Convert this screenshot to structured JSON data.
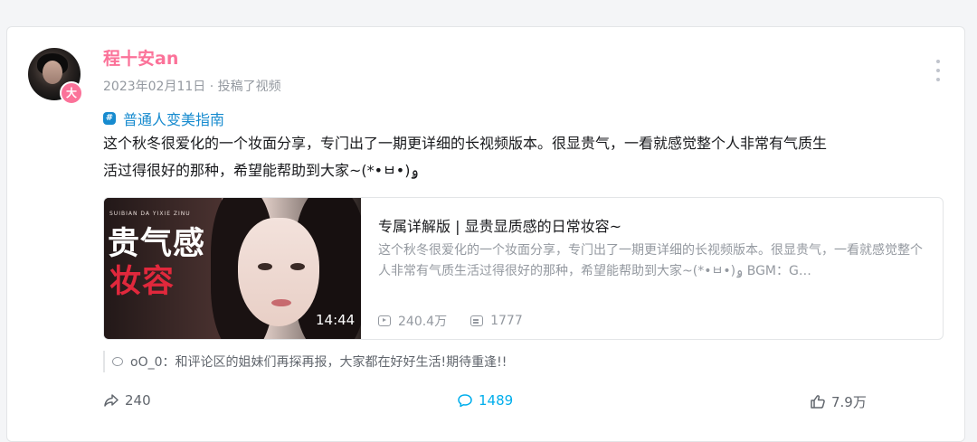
{
  "post": {
    "author": "程十安an",
    "avatar_badge": "大",
    "meta": "2023年02月11日 · 投稿了视频",
    "topic": "普通人变美指南",
    "topic_icon": "#",
    "content_line1": "这个秋冬很爱化的一个妆面分享，专门出了一期更详细的长视频版本。很显贵气，一看就感觉整个人非常有气质生",
    "content_line2": "活过得很好的那种，希望能帮助到大家~(*•ㅂ•)ۅ"
  },
  "video": {
    "thumb_small_text": "SUIBIAN DA YIXIE ZINU",
    "thumb_title_1": "贵气感",
    "thumb_title_2": "妆容",
    "duration": "14:44",
    "title": "专属详解版 | 显贵显质感的日常妆容~",
    "description": "这个秋冬很爱化的一个妆面分享，专门出了一期更详细的长视频版本。很显贵气，一看就感觉整个人非常有气质生活过得很好的那种，希望能帮助到大家~(*•ㅂ•)ۅ BGM：G…",
    "views": "240.4万",
    "danmaku": "1777"
  },
  "pinned_comment": "oO_0：和评论区的姐妹们再探再报，大家都在好好生活!期待重逢!!",
  "actions": {
    "forward": "240",
    "comment": "1489",
    "like": "7.9万"
  },
  "colors": {
    "accent_pink": "#fb7299",
    "link_blue": "#178bcf",
    "comment_blue": "#00aeec",
    "muted": "#9499a0"
  }
}
